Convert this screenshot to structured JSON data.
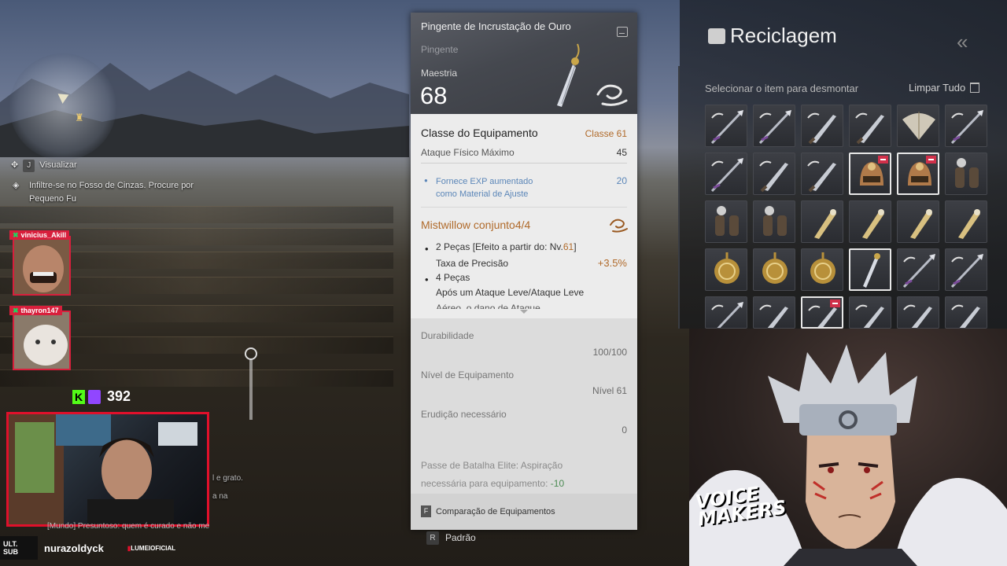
{
  "hud": {
    "view_key": "J",
    "view_label": "Visualizar",
    "quest_line1": "Infiltre-se no Fosso de Cinzas. Procure por",
    "quest_line2": "Pequeno Fu"
  },
  "stream": {
    "cam1_user": "vinicius_Akill",
    "cam2_user": "thayron147",
    "viewer_count": "392",
    "chat_line1": "l e grato.",
    "chat_line2": "a na",
    "chat_line3": "[Mundo] Presuntoso: quem é curado e não me",
    "ult_badge_line1": "ULT.",
    "ult_badge_line2": "SUB",
    "handle": "nurazoldyck",
    "sponsor": "LUMEIOFICIAL"
  },
  "tooltip": {
    "item_name": "Pingente de Incrustação de Ouro",
    "item_type": "Pingente",
    "mastery_label": "Maestria",
    "mastery_value": "68",
    "class_label": "Classe do Equipamento",
    "class_value": "Classe 61",
    "attack_label": "Ataque Físico Máximo",
    "attack_value": "45",
    "exp_line1": "Fornece EXP aumentado",
    "exp_line2": "como Material de Ajuste",
    "exp_value": "20",
    "set_name": "Mistwillow conjunto4/4",
    "set_2pc_label": "2 Peças [Efeito a partir do: Nv.",
    "set_2pc_level": "61",
    "set_2pc_close": "]",
    "set_precision_label": "Taxa de Precisão",
    "set_precision_value": "+3.5%",
    "set_4pc_label": "4 Peças",
    "set_4pc_desc": "Após um Ataque Leve/Ataque Leve",
    "set_4pc_cut": "Aéreo, o dano de Ataque",
    "durability_label": "Durabilidade",
    "durability_value": "100/100",
    "equip_level_label": "Nível de Equipamento",
    "equip_level_value": "Nível 61",
    "erudition_label": "Erudição necessário",
    "erudition_value": "0",
    "battlepass_line1": "Passe de Batalha Elite: Aspiração",
    "battlepass_line2": "necessária para equipamento: ",
    "battlepass_value": "-10",
    "compare_key": "F",
    "compare_label": "Comparação de Equipamentos",
    "default_key": "R",
    "default_label": "Padrão"
  },
  "recycle": {
    "title": "Reciclagem",
    "hint": "Selecionar o item para desmontar",
    "clear_all": "Limpar Tudo",
    "slots": [
      {
        "icon": "spear-icon",
        "selected": false,
        "marked": false
      },
      {
        "icon": "spear-icon",
        "selected": false,
        "marked": false
      },
      {
        "icon": "blade-icon",
        "selected": false,
        "marked": false
      },
      {
        "icon": "blade-icon",
        "selected": false,
        "marked": false
      },
      {
        "icon": "fan-icon",
        "selected": false,
        "marked": false
      },
      {
        "icon": "spear-icon",
        "selected": false,
        "marked": false
      },
      {
        "icon": "spear-icon",
        "selected": false,
        "marked": false
      },
      {
        "icon": "blade-icon",
        "selected": false,
        "marked": false
      },
      {
        "icon": "blade-icon",
        "selected": false,
        "marked": false
      },
      {
        "icon": "helmet-icon",
        "selected": true,
        "marked": true
      },
      {
        "icon": "helmet-icon",
        "selected": true,
        "marked": true
      },
      {
        "icon": "gauntlet-icon",
        "selected": false,
        "marked": false
      },
      {
        "icon": "gauntlet-icon",
        "selected": false,
        "marked": false
      },
      {
        "icon": "gauntlet-icon",
        "selected": false,
        "marked": false
      },
      {
        "icon": "bracer-icon",
        "selected": false,
        "marked": false
      },
      {
        "icon": "bracer-icon",
        "selected": false,
        "marked": false
      },
      {
        "icon": "bracer-icon",
        "selected": false,
        "marked": false
      },
      {
        "icon": "bracer-icon",
        "selected": false,
        "marked": false
      },
      {
        "icon": "amulet-icon",
        "selected": false,
        "marked": false
      },
      {
        "icon": "amulet-icon",
        "selected": false,
        "marked": false
      },
      {
        "icon": "amulet-icon",
        "selected": false,
        "marked": false
      },
      {
        "icon": "pendant-icon",
        "selected": true,
        "marked": false
      },
      {
        "icon": "spear-icon",
        "selected": false,
        "marked": false
      },
      {
        "icon": "spear-icon",
        "selected": false,
        "marked": false
      },
      {
        "icon": "spear-icon",
        "selected": false,
        "marked": false
      },
      {
        "icon": "blade-icon",
        "selected": false,
        "marked": false
      },
      {
        "icon": "blade-icon",
        "selected": true,
        "marked": true
      },
      {
        "icon": "blade-icon",
        "selected": false,
        "marked": false
      },
      {
        "icon": "blade-icon",
        "selected": false,
        "marked": false
      },
      {
        "icon": "blade-icon",
        "selected": false,
        "marked": false
      }
    ]
  },
  "overlay": {
    "logo_line1": "VOICE",
    "logo_line2": "MAKERS"
  }
}
